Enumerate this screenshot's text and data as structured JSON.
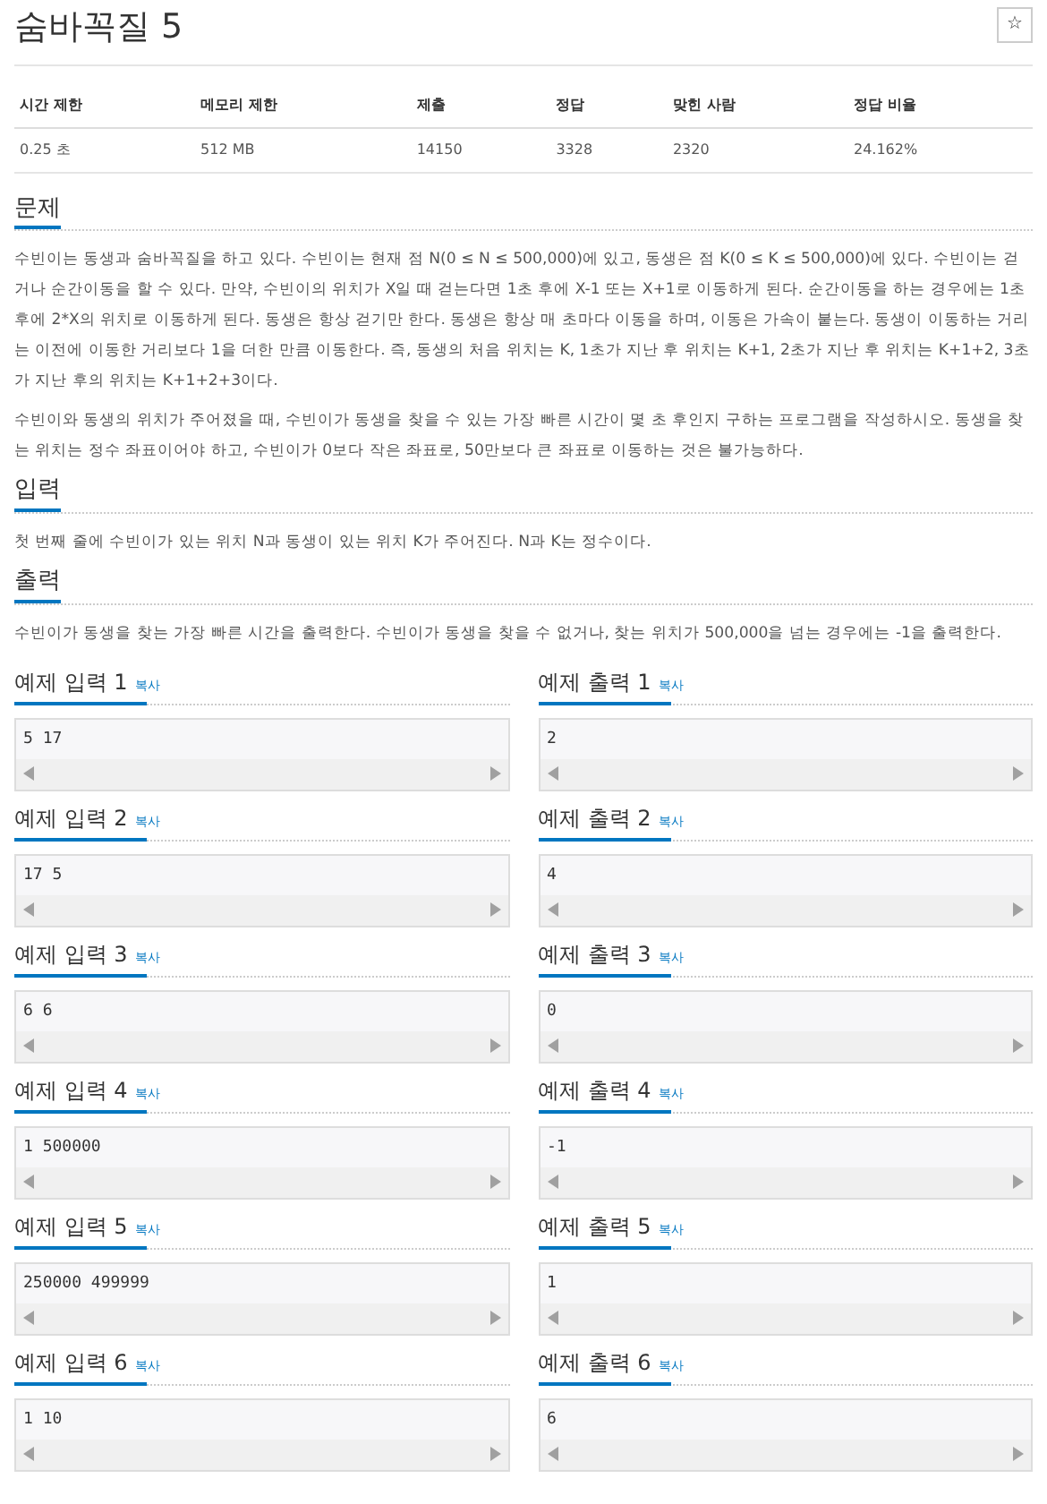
{
  "title": "숨바꼭질 5",
  "star_button": "☆",
  "stats": {
    "columns": [
      "시간 제한",
      "메모리 제한",
      "제출",
      "정답",
      "맞힌 사람",
      "정답 비율"
    ],
    "values": [
      "0.25 초",
      "512 MB",
      "14150",
      "3328",
      "2320",
      "24.162%"
    ]
  },
  "sections": [
    {
      "heading": "문제",
      "paragraphs": [
        "수빈이는 동생과 숨바꼭질을 하고 있다. 수빈이는 현재 점 N(0 ≤ N ≤ 500,000)에 있고, 동생은 점 K(0 ≤ K ≤ 500,000)에 있다. 수빈이는 걷거나 순간이동을 할 수 있다. 만약, 수빈이의 위치가 X일 때 걷는다면 1초 후에 X-1 또는 X+1로 이동하게 된다. 순간이동을 하는 경우에는 1초 후에 2*X의 위치로 이동하게 된다. 동생은 항상 걷기만 한다. 동생은 항상 매 초마다 이동을 하며, 이동은 가속이 붙는다. 동생이 이동하는 거리는 이전에 이동한 거리보다 1을 더한 만큼 이동한다. 즉, 동생의 처음 위치는 K, 1초가 지난 후 위치는 K+1, 2초가 지난 후 위치는 K+1+2, 3초가 지난 후의 위치는 K+1+2+3이다.",
        "수빈이와 동생의 위치가 주어졌을 때, 수빈이가 동생을 찾을 수 있는 가장 빠른 시간이 몇 초 후인지 구하는 프로그램을 작성하시오. 동생을 찾는 위치는 정수 좌표이어야 하고, 수빈이가 0보다 작은 좌표로, 50만보다 큰 좌표로 이동하는 것은 불가능하다."
      ]
    },
    {
      "heading": "입력",
      "paragraphs": [
        "첫 번째 줄에 수빈이가 있는 위치 N과 동생이 있는 위치 K가 주어진다. N과 K는 정수이다."
      ]
    },
    {
      "heading": "출력",
      "paragraphs": [
        "수빈이가 동생을 찾는 가장 빠른 시간을 출력한다. 수빈이가 동생을 찾을 수 없거나, 찾는 위치가 500,000을 넘는 경우에는 -1을 출력한다."
      ]
    }
  ],
  "examples": [
    {
      "input_heading": "예제 입력 1",
      "input_copy": "복사",
      "input": "5 17",
      "output_heading": "예제 출력 1",
      "output_copy": "복사",
      "output": "2"
    },
    {
      "input_heading": "예제 입력 2",
      "input_copy": "복사",
      "input": "17 5",
      "output_heading": "예제 출력 2",
      "output_copy": "복사",
      "output": "4"
    },
    {
      "input_heading": "예제 입력 3",
      "input_copy": "복사",
      "input": "6 6",
      "output_heading": "예제 출력 3",
      "output_copy": "복사",
      "output": "0"
    },
    {
      "input_heading": "예제 입력 4",
      "input_copy": "복사",
      "input": "1 500000",
      "output_heading": "예제 출력 4",
      "output_copy": "복사",
      "output": "-1"
    },
    {
      "input_heading": "예제 입력 5",
      "input_copy": "복사",
      "input": "250000 499999",
      "output_heading": "예제 출력 5",
      "output_copy": "복사",
      "output": "1"
    },
    {
      "input_heading": "예제 입력 6",
      "input_copy": "복사",
      "input": "1 10",
      "output_heading": "예제 출력 6",
      "output_copy": "복사",
      "output": "6"
    }
  ]
}
